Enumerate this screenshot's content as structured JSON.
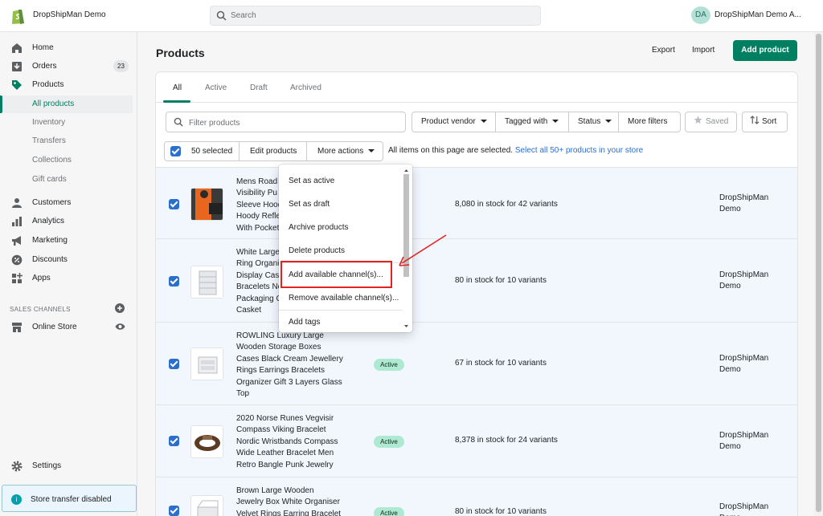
{
  "topbar": {
    "store_name": "DropShipMan Demo",
    "search_placeholder": "Search",
    "avatar_initials": "DA",
    "user_name": "DropShipMan Demo A..."
  },
  "sidebar": {
    "items": [
      {
        "label": "Home",
        "icon": "home-icon"
      },
      {
        "label": "Orders",
        "icon": "orders-icon",
        "badge": "23"
      },
      {
        "label": "Products",
        "icon": "tag-icon"
      },
      {
        "label": "All products"
      },
      {
        "label": "Inventory"
      },
      {
        "label": "Transfers"
      },
      {
        "label": "Collections"
      },
      {
        "label": "Gift cards"
      },
      {
        "label": "Customers",
        "icon": "person-icon"
      },
      {
        "label": "Analytics",
        "icon": "bar-chart-icon"
      },
      {
        "label": "Marketing",
        "icon": "megaphone-icon"
      },
      {
        "label": "Discounts",
        "icon": "discount-icon"
      },
      {
        "label": "Apps",
        "icon": "apps-icon"
      }
    ],
    "sales_channels_heading": "SALES CHANNELS",
    "online_store": "Online Store",
    "settings": "Settings",
    "transfer_notice": "Store transfer disabled"
  },
  "header": {
    "title": "Products",
    "export": "Export",
    "import": "Import",
    "add_product": "Add product"
  },
  "tabs": [
    "All",
    "Active",
    "Draft",
    "Archived"
  ],
  "filters": {
    "placeholder": "Filter products",
    "vendor": "Product vendor",
    "tagged": "Tagged with",
    "status": "Status",
    "more": "More filters",
    "saved": "Saved",
    "sort": "Sort"
  },
  "bulk": {
    "selected": "50 selected",
    "edit": "Edit products",
    "more_actions": "More actions",
    "all_items_text": "All items on this page are selected.",
    "select_all_link": "Select all 50+ products in your store"
  },
  "menu": [
    "Set as active",
    "Set as draft",
    "Archive products",
    "Delete products",
    "Add available channel(s)...",
    "Remove available channel(s)...",
    "Add tags"
  ],
  "products": [
    {
      "name": "Mens Road\nVisibility Pu\nSleeve Hood\nHoody Refle\nWith Pocket",
      "status": "",
      "stock": "8,080 in stock for 42 variants",
      "vendor": "DropShipMan\nDemo"
    },
    {
      "name": "White Large\nRing Organi\nDisplay Case\nBracelets Ne\nPackaging C\nCasket",
      "status": "",
      "stock": "80 in stock for 10 variants",
      "vendor": "DropShipMan\nDemo"
    },
    {
      "name": "ROWLING Luxury Large\nWooden Storage Boxes\nCases Black Cream Jewellery\nRings Earrings Bracelets\nOrganizer Gift 3 Layers Glass\nTop",
      "status": "Active",
      "stock": "67 in stock for 10 variants",
      "vendor": "DropShipMan\nDemo"
    },
    {
      "name": "2020 Norse Runes Vegvisir\nCompass Viking Bracelet\nNordic Wristbands Compass\nWide Leather Bracelet Men\nRetro Bangle Punk Jewelry",
      "status": "Active",
      "stock": "8,378 in stock for 24 variants",
      "vendor": "DropShipMan\nDemo"
    },
    {
      "name": "Brown Large Wooden\nJewelry Box White Organiser\nVelvet Rings Earring Bracelet",
      "status": "Active",
      "stock": "80 in stock for 10 variants",
      "vendor": "DropShipMan\nDemo"
    }
  ],
  "colors": {
    "accent": "#008060",
    "highlight": "#e02323",
    "selected_row": "#f2f7fe"
  }
}
